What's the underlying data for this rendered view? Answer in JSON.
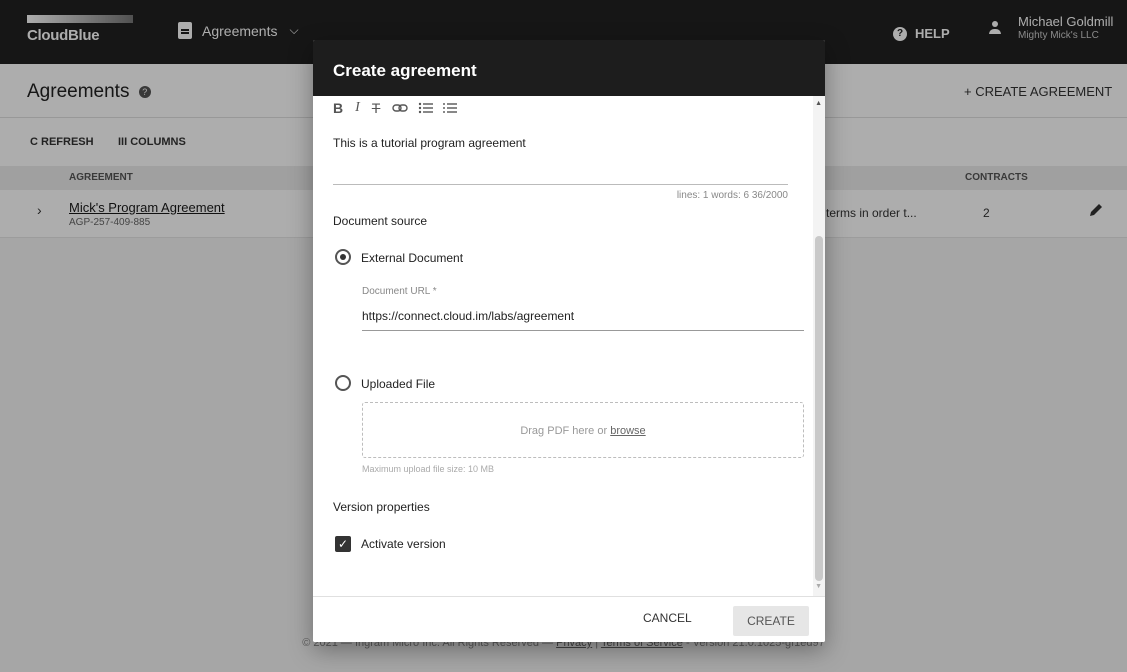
{
  "topbar": {
    "brand": "CloudBlue",
    "module": "Agreements",
    "help": "HELP",
    "user_name": "Michael Goldmill",
    "user_company": "Mighty Mick's LLC"
  },
  "page": {
    "title": "Agreements",
    "create_button": "+ CREATE AGREEMENT",
    "refresh_button": "C REFRESH",
    "columns_button": "III COLUMNS",
    "columns": [
      "AGREEMENT",
      "CONTRACTS"
    ],
    "rows": [
      {
        "name": "Mick's Program Agreement",
        "id": "AGP-257-409-885",
        "description": "terms in order t...",
        "contracts": "2"
      }
    ],
    "footer": {
      "copyright": "© 2021 — Ingram Micro Inc. All Rights Reserved —",
      "privacy": "Privacy",
      "terms": "Terms of Service",
      "version": "- Version 21.0.1025-gf1ed97"
    }
  },
  "dialog": {
    "title": "Create agreement",
    "formatting": [
      "B",
      "I",
      "T",
      "link",
      "ul",
      "ol"
    ],
    "editor_text": "This is a tutorial program agreement",
    "counter": "lines: 1   words: 6   36/2000",
    "document_source_label": "Document source",
    "external_option": "External Document",
    "url_label": "Document URL *",
    "url_value": "https://connect.cloud.im/labs/agreement",
    "uploaded_option": "Uploaded File",
    "drop_text": "Drag PDF here or",
    "browse_link": "browse",
    "max_size": "Maximum upload file size: 10 MB",
    "version_props_label": "Version properties",
    "activate_label": "Activate version",
    "cancel_button": "CANCEL",
    "create_button": "CREATE"
  }
}
